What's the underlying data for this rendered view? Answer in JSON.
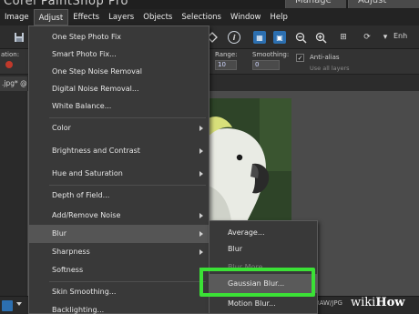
{
  "titlebar": {
    "app_title": "Corel PaintShop Pro",
    "workspace_tabs": [
      "Manage",
      "Adjust"
    ]
  },
  "menubar": {
    "items": [
      "Image",
      "Adjust",
      "Effects",
      "Layers",
      "Objects",
      "Selections",
      "Window",
      "Help"
    ],
    "active": "Adjust"
  },
  "toolbar": {
    "icons": [
      "save-icon",
      "info-icon",
      "histogram-icon",
      "crop-icon",
      "zoom-out-icon",
      "zoom-in-icon",
      "grid-icon",
      "enhance-icon"
    ],
    "enhance_label": "Enh"
  },
  "options": {
    "tool_label": "ation:",
    "range_label": "Range:",
    "range_value": "10",
    "smoothing_label": "Smoothing:",
    "smoothing_value": "0",
    "antialias_label": "Anti-alias",
    "use_all_layers_label": "Use all layers"
  },
  "document": {
    "tab_label": ".jpg* @"
  },
  "adjust_menu": {
    "items": [
      {
        "label": "One Step Photo Fix",
        "submenu": false
      },
      {
        "label": "Smart Photo Fix...",
        "submenu": false
      },
      {
        "label": "One Step Noise Removal",
        "submenu": false
      },
      {
        "label": "Digital Noise Removal...",
        "submenu": false
      },
      {
        "label": "White Balance...",
        "submenu": false
      },
      {
        "label": "Color",
        "submenu": true
      },
      {
        "label": "Brightness and Contrast",
        "submenu": true
      },
      {
        "label": "Hue and Saturation",
        "submenu": true
      },
      {
        "label": "Depth of Field...",
        "submenu": false
      },
      {
        "label": "Add/Remove Noise",
        "submenu": true
      },
      {
        "label": "Blur",
        "submenu": true
      },
      {
        "label": "Sharpness",
        "submenu": true
      },
      {
        "label": "Softness",
        "submenu": true
      },
      {
        "label": "Skin Smoothing...",
        "submenu": false
      },
      {
        "label": "Backlighting...",
        "submenu": false
      }
    ],
    "highlighted": "Blur"
  },
  "blur_submenu": {
    "items": [
      "Average...",
      "Blur",
      "Blur More",
      "Gaussian Blur...",
      "Motion Blur..."
    ],
    "selected": "Gaussian Blur..."
  },
  "statusbar": {
    "text": "RAW/JPG"
  },
  "watermark": {
    "prefix": "wiki",
    "suffix": "How"
  },
  "colors": {
    "highlight_box": "#3be136",
    "menu_bg": "#393939",
    "menubar_bg": "#232323"
  }
}
